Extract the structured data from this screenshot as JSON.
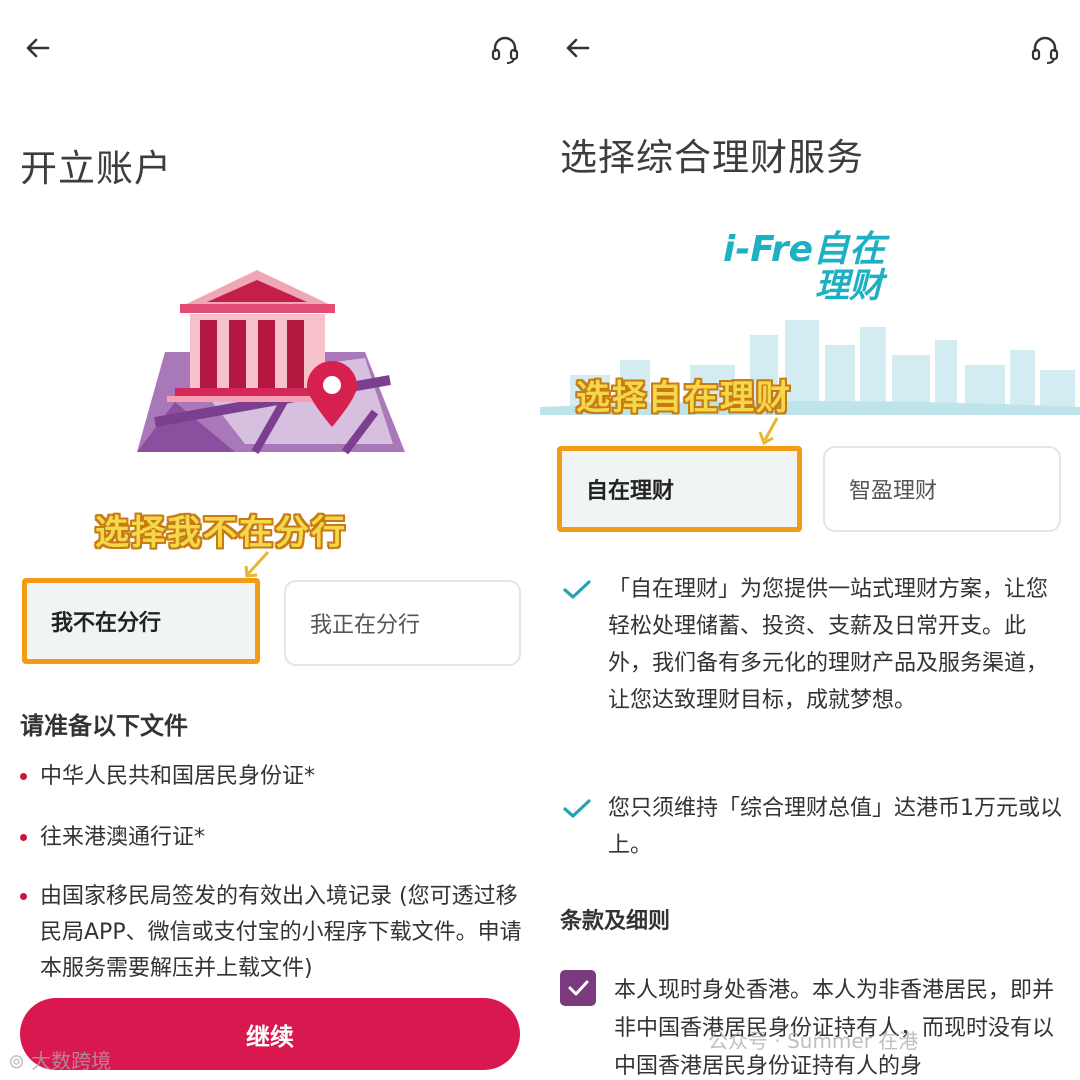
{
  "left": {
    "title": "开立账户",
    "annotation": "选择我不在分行",
    "options": [
      "我不在分行",
      "我正在分行"
    ],
    "docs_title": "请准备以下文件",
    "docs": [
      "中华人民共和国居民身份证*",
      "往来港澳通行证*",
      "由国家移民局签发的有效出入境记录 (您可透过移民局APP、微信或支付宝的小程序下载文件。申请本服务需要解压并上载文件)"
    ],
    "continue_label": "继续"
  },
  "right": {
    "title": "选择综合理财服务",
    "logo_text_line1": "i-Fre自在",
    "logo_text_line2": "理财",
    "annotation": "选择自在理财",
    "options": [
      "自在理财",
      "智盈理财"
    ],
    "features": [
      "「自在理财」为您提供一站式理财方案，让您轻松处理储蓄、投资、支薪及日常开支。此外，我们备有多元化的理财产品及服务渠道，让您达致理财目标，成就梦想。",
      "您只须维持「综合理财总值」达港币1万元或以上。"
    ],
    "terms_title": "条款及细则",
    "terms_text": "本人现时身处香港。本人为非香港居民，即并非中国香港居民身份证持有人，而现时没有以中国香港居民身份证持有人的身"
  },
  "watermarks": {
    "bottom_left": "大数跨境",
    "bottom_right": "公众号 · Summer 在港"
  },
  "colors": {
    "brand": "#d8184f",
    "highlight_border": "#f29b14",
    "check": "#25a3b5",
    "checkbox": "#7a3b7e",
    "bullet": "#c8153c"
  },
  "icons": [
    "back-arrow-icon",
    "headset-icon",
    "bank-map-illustration",
    "check-icon",
    "checkbox-icon"
  ]
}
